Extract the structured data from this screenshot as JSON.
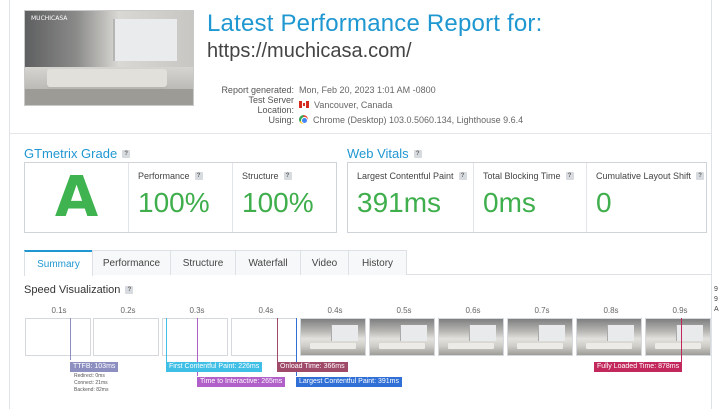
{
  "header": {
    "title": "Latest Performance Report for:",
    "url": "https://muchicasa.com/",
    "thumbnail_stamp": "MUCHICASA"
  },
  "meta": [
    {
      "label": "Report generated:",
      "value": "Mon, Feb 20, 2023 1:01 AM -0800",
      "icon": ""
    },
    {
      "label": "Test Server Location:",
      "value": "Vancouver, Canada",
      "icon": "canada-flag-icon"
    },
    {
      "label": "Using:",
      "value": "Chrome (Desktop) 103.0.5060.134, Lighthouse 9.6.4",
      "icon": "chrome-icon"
    }
  ],
  "grade": {
    "heading": "GTmetrix Grade",
    "help": "?",
    "letter": "A",
    "performance_label": "Performance",
    "performance_value": "100%",
    "structure_label": "Structure",
    "structure_value": "100%"
  },
  "vitals": {
    "heading": "Web Vitals",
    "help": "?",
    "lcp_label": "Largest Contentful Paint",
    "lcp_value": "391ms",
    "tbt_label": "Total Blocking Time",
    "tbt_value": "0ms",
    "cls_label": "Cumulative Layout Shift",
    "cls_value": "0"
  },
  "tabs": [
    "Summary",
    "Performance",
    "Structure",
    "Waterfall",
    "Video",
    "History"
  ],
  "speed": {
    "heading": "Speed Visualization",
    "help": "?",
    "ticks": [
      "0.1s",
      "0.2s",
      "0.3s",
      "0.4s",
      "0.4s",
      "0.5s",
      "0.6s",
      "0.7s",
      "0.8s",
      "0.9s"
    ],
    "ttfb_label": "TTFB: 103ms",
    "ttfb_sub": [
      "Redirect: 0ms",
      "Connect: 21ms",
      "Backend: 82ms"
    ],
    "fcp_label": "First Contentful Paint: 226ms",
    "tti_label": "Time to Interactive: 265ms",
    "onload_label": "Onload Time: 366ms",
    "lcp_label": "Largest Contentful Paint: 391ms",
    "fully_loaded_label": "Fully Loaded Time: 878ms"
  },
  "edge_note": [
    "9",
    "9",
    "A"
  ],
  "colors": {
    "accent": "#1f97d1",
    "grade_green": "#3fae4c",
    "ttfb": "#8c8fc0",
    "fcp": "#3fbfe6",
    "tti": "#b060c8",
    "onload": "#a04a6a",
    "lcp": "#2f6fd6",
    "fully_loaded": "#c2285c"
  }
}
